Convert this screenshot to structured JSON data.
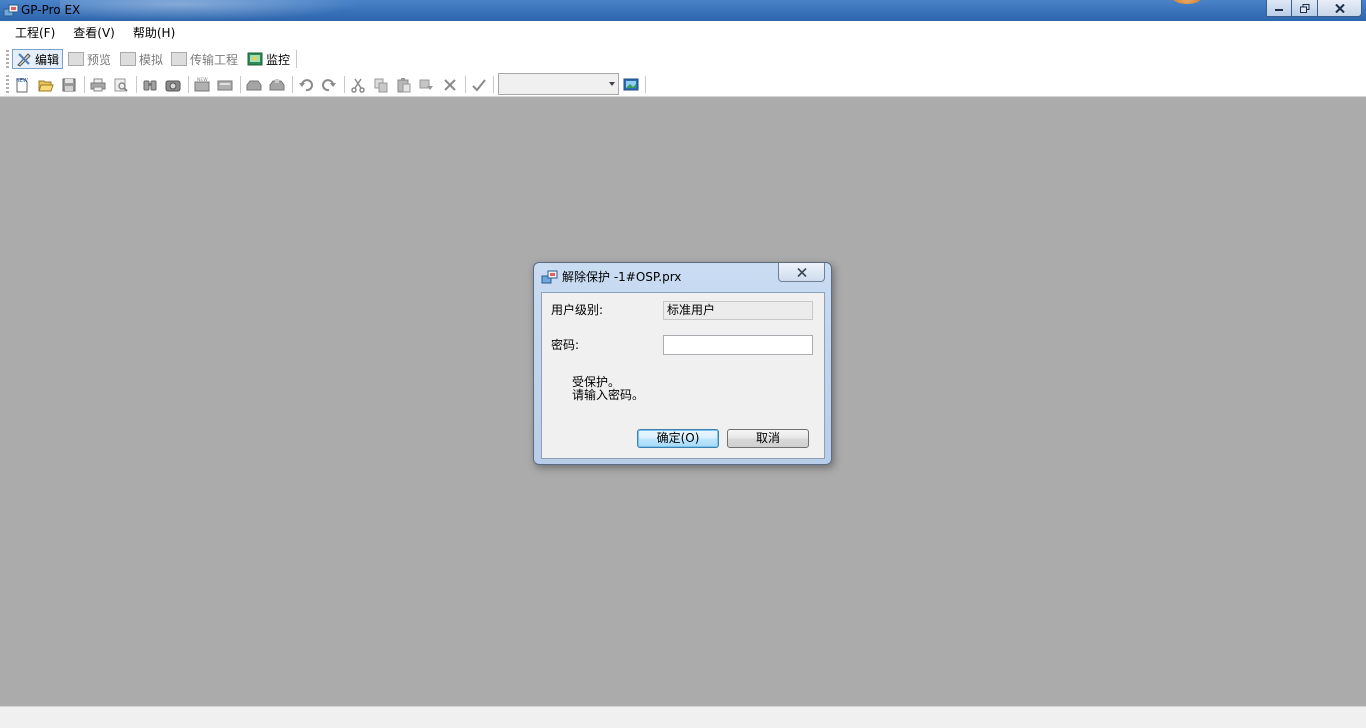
{
  "window": {
    "title": "GP-Pro EX"
  },
  "menu": {
    "items": [
      {
        "label": "工程(F)"
      },
      {
        "label": "查看(V)"
      },
      {
        "label": "帮助(H)"
      }
    ]
  },
  "mode_toolbar": {
    "items": [
      {
        "label": "编辑",
        "state": "active"
      },
      {
        "label": "预览",
        "state": "disabled"
      },
      {
        "label": "模拟",
        "state": "disabled"
      },
      {
        "label": "传输工程",
        "state": "disabled"
      },
      {
        "label": "监控",
        "state": "enabled"
      }
    ]
  },
  "toolbar": {
    "icons": [
      "new-icon",
      "open-icon",
      "save-icon",
      "print-icon",
      "print-preview-icon",
      "find-icon",
      "camera-icon",
      "new-screen-icon",
      "screen-list-icon",
      "import-icon",
      "export-icon",
      "undo-icon",
      "redo-icon",
      "cut-icon",
      "copy-icon",
      "paste-icon",
      "duplicate-icon",
      "delete-icon",
      "error-check-icon",
      "screen-image-icon"
    ],
    "combo_value": ""
  },
  "dialog": {
    "title": "解除保护 -1#OSP.prx",
    "user_level_label": "用户级别:",
    "user_level_value": "标准用户",
    "password_label": "密码:",
    "password_value": "",
    "message_line1": "受保护。",
    "message_line2": "请输入密码。",
    "ok_label": "确定(O)",
    "cancel_label": "取消"
  },
  "colors": {
    "workspace": "#ababab",
    "titlebar": "#3a73bb",
    "dialog_frame": "#c9dcf2",
    "default_button": "#bee6fd"
  }
}
